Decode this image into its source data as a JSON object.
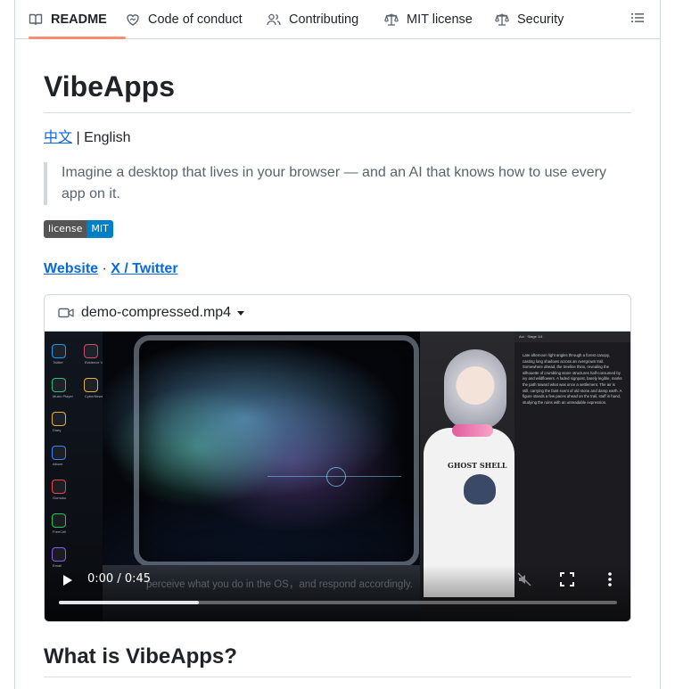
{
  "tabs": [
    {
      "label": "README",
      "icon": "book-icon",
      "active": true
    },
    {
      "label": "Code of conduct",
      "icon": "heart-icon",
      "active": false
    },
    {
      "label": "Contributing",
      "icon": "people-icon",
      "active": false
    },
    {
      "label": "MIT license",
      "icon": "law-icon",
      "active": false
    },
    {
      "label": "Security",
      "icon": "law-icon",
      "active": false
    }
  ],
  "outline_icon": "list-unordered-icon",
  "article": {
    "title": "VibeApps",
    "lang_zh": "中文",
    "lang_sep": " | ",
    "lang_en": "English",
    "quote": "Imagine a desktop that lives in your browser — and an AI that knows how to use every app on it.",
    "badge": {
      "left": "license",
      "right": "MIT",
      "left_color": "#555555",
      "right_color": "#007ec6"
    },
    "website_link": "Website",
    "dot_sep": " · ",
    "twitter_link": "X / Twitter",
    "section_heading": "What is VibeApps?"
  },
  "video": {
    "filename": "demo-compressed.mp4",
    "time": "0:00 / 0:45",
    "progress_fraction": 0.25,
    "subtitle": "perceive what you do in the OS，and respond accordingly.",
    "dock_items": [
      {
        "label": "Twitter",
        "color": "#1d9bf0"
      },
      {
        "label": "Evidence Vault",
        "color": "#d14b6b"
      },
      {
        "label": "Music Player",
        "color": "#2fbf71"
      },
      {
        "label": "CyberNews",
        "color": "#e3b341"
      },
      {
        "label": "Diary",
        "color": "#e3b341"
      },
      {
        "label": "Album",
        "color": "#3b82f6"
      },
      {
        "label": "Gomoku",
        "color": "#ef4444"
      },
      {
        "label": "FreeCell",
        "color": "#22c55e"
      },
      {
        "label": "Email",
        "color": "#8b5cf6"
      }
    ],
    "side_panel_header": "Aoi · Stage 1/4",
    "side_panel_text": "Late afternoon light angles through a forest canopy, casting long shadows across an overgrown trail. Somewhere ahead, the treeline thins, revealing the silhouette of crumbling stone structures half-consumed by ivy and wildflowers. A faded signpost, barely legible, marks the path toward what was once a settlement. The air is still, carrying the faint scent of old stone and damp earth. A figure stands a few paces ahead on the trail, staff in hand, studying the ruins with an unreadable expression.",
    "shirt_text": "GHOST SHELL"
  }
}
